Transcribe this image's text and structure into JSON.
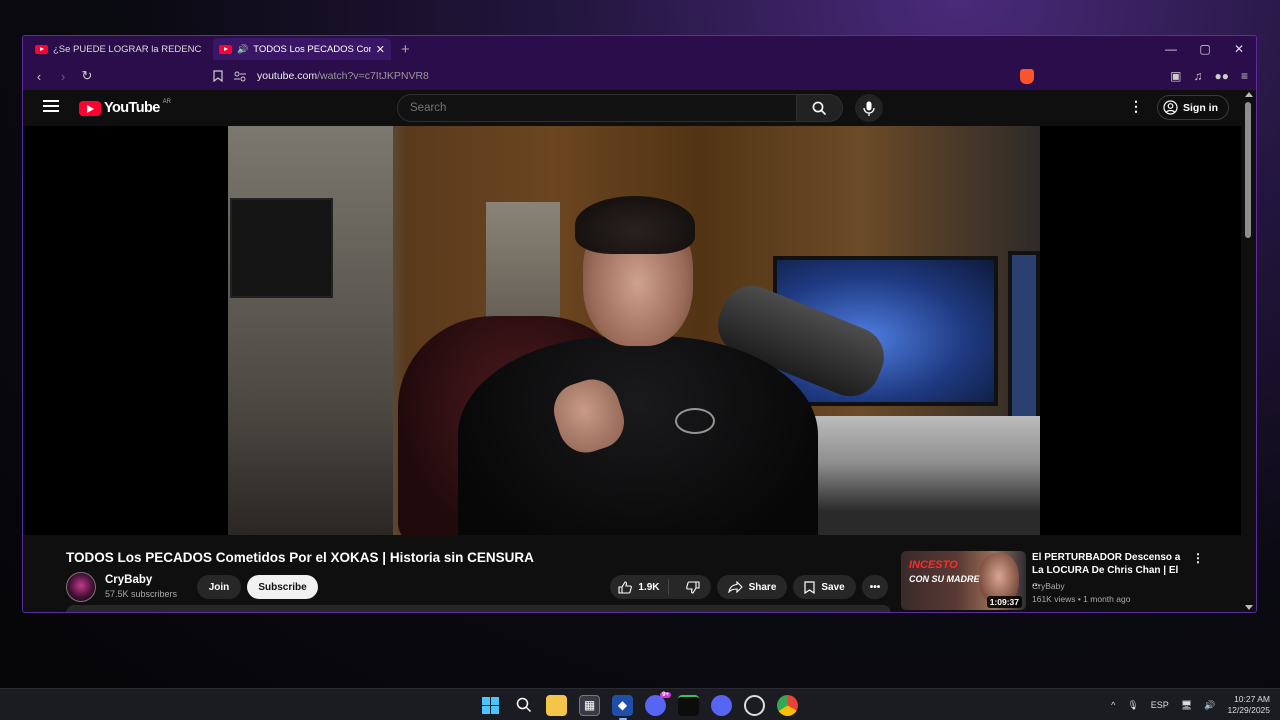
{
  "browser": {
    "tabs": [
      {
        "label": "¿Se PUEDE LOGRAR la REDENCIÓN?",
        "active": false
      },
      {
        "label": "TODOS Los PECADOS Cometi",
        "active": true,
        "close": "✕"
      }
    ],
    "new_tab": "+",
    "window_controls": {
      "minimize": "—",
      "maximize": "▢",
      "close": "✕"
    },
    "nav": {
      "back": "‹",
      "forward": "›",
      "reload": "↻"
    },
    "url_host": "youtube.com",
    "url_path": "/watch?v=c7ItJKPNVR8",
    "accent": "#5b2fa0"
  },
  "youtube": {
    "logo_text": "YouTube",
    "country": "AR",
    "search_placeholder": "Search",
    "sign_in": "Sign in",
    "video": {
      "title": "TODOS Los PECADOS Cometidos Por el XOKAS | Historia sin CENSURA",
      "channel": "CryBaby",
      "subscribers": "57.5K subscribers",
      "join": "Join",
      "subscribe": "Subscribe",
      "likes": "1.9K",
      "share": "Share",
      "save": "Save",
      "more": "•••"
    },
    "recommended": [
      {
        "thumb_text_1": "INCESTO",
        "thumb_text_2": "CON SU MADRE",
        "duration": "1:09:37",
        "title": "El PERTURBADOR Descenso a La LOCURA De Chris Chan | El ...",
        "channel": "CryBaby",
        "meta": "161K views • 1 month ago"
      }
    ]
  },
  "taskbar": {
    "language": "ESP",
    "time": "10:27 AM",
    "date": "12/29/2025",
    "discord_badge": "9+"
  }
}
